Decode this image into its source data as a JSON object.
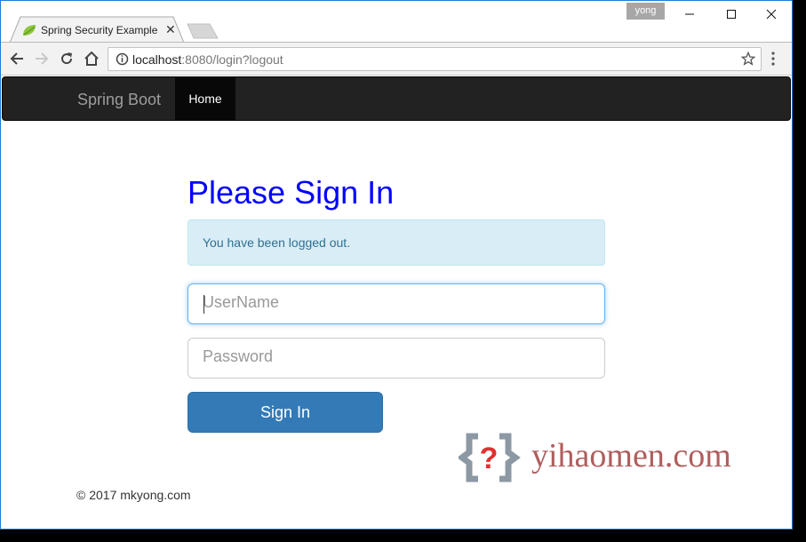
{
  "browser": {
    "tab_title": "Spring Security Example",
    "profile_name": "yong",
    "url_host": "localhost",
    "url_rest": ":8080/login?logout",
    "icons": {
      "favicon": "spring-leaf-icon",
      "tab_close": "close-icon",
      "back": "arrow-left-icon",
      "forward": "arrow-right-icon",
      "reload": "reload-icon",
      "home": "home-icon",
      "site_info": "info-icon",
      "bookmark": "star-icon",
      "menu": "vertical-dots-icon",
      "minimize": "minimize-icon",
      "maximize": "maximize-icon",
      "close": "close-icon"
    }
  },
  "navbar": {
    "brand": "Spring Boot",
    "items": [
      {
        "label": "Home",
        "active": true
      }
    ]
  },
  "main": {
    "heading": "Please Sign In",
    "alert": "You have been logged out.",
    "username_placeholder": "UserName",
    "username_value": "",
    "password_placeholder": "Password",
    "password_value": "",
    "submit_label": "Sign In"
  },
  "footer": {
    "copyright": "© 2017 mkyong.com"
  },
  "watermark": {
    "text": "yihaomen.com"
  },
  "colors": {
    "heading": "#0000ff",
    "primary_button": "#337ab7",
    "alert_bg": "#d9edf7",
    "alert_text": "#31708f",
    "navbar_bg": "#222222",
    "watermark_text": "#b05d5d"
  }
}
